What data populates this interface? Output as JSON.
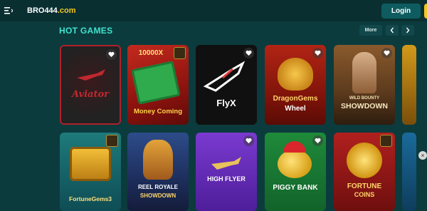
{
  "header": {
    "logo_main": "BRO444",
    "logo_suffix": ".com",
    "login_label": "Login"
  },
  "section": {
    "title": "HOT GAMES",
    "more_label": "More",
    "prev_icon": "chevron-left-icon",
    "next_icon": "chevron-right-icon"
  },
  "games_row1": [
    {
      "name": "Aviator",
      "art_text": "Aviator"
    },
    {
      "name": "Money Coming",
      "art_top": "10000X",
      "art_text": "Money Coming"
    },
    {
      "name": "FlyX",
      "art_text": "FlyX"
    },
    {
      "name": "Dragon Gems Wheel",
      "art_text": "DragonGems",
      "art_sub": "Wheel"
    },
    {
      "name": "Wild Bounty Showdown",
      "art_top": "WILD BOUNTY",
      "art_text": "SHOWDOWN"
    }
  ],
  "games_row2": [
    {
      "name": "Fortune Gems 3",
      "art_text": "FortuneGems3"
    },
    {
      "name": "Reel Royale Showdown",
      "art_text": "REEL ROYALE",
      "art_sub": "SHOWDOWN"
    },
    {
      "name": "High Flyer",
      "art_text": "HIGH FLYER"
    },
    {
      "name": "Piggy Bank",
      "art_text": "PIGGY BANK"
    },
    {
      "name": "Fortune Coins",
      "art_text": "FORTUNE",
      "art_sub": "COINS"
    }
  ],
  "colors": {
    "background": "#0c3b3d",
    "accent_title": "#3fe3cf",
    "logo_accent": "#f3c623",
    "login_bg": "#0f5c60"
  }
}
